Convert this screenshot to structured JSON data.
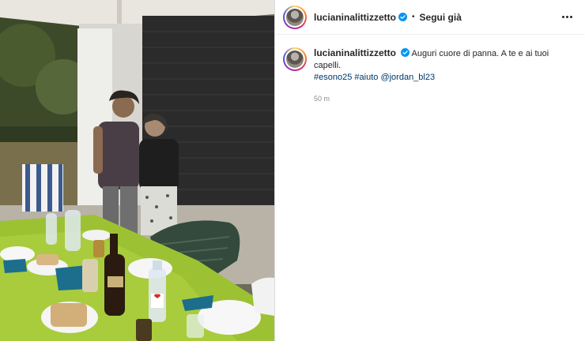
{
  "post": {
    "username": "lucianinalittizzetto",
    "separator": "•",
    "follow_label": "Segui già",
    "caption": {
      "username": "lucianinalittizzetto",
      "text": "Auguri cuore di panna. A te e ai tuoi capelli.",
      "hashtags": [
        "#esono25",
        "#aiuto"
      ],
      "mention": "@jordan_bl23",
      "time": "50 m"
    },
    "icons": {
      "verified": "verified-badge-icon",
      "more": "more-options-icon"
    },
    "colors": {
      "accent_link": "#00376b",
      "verified": "#0095f6"
    }
  }
}
